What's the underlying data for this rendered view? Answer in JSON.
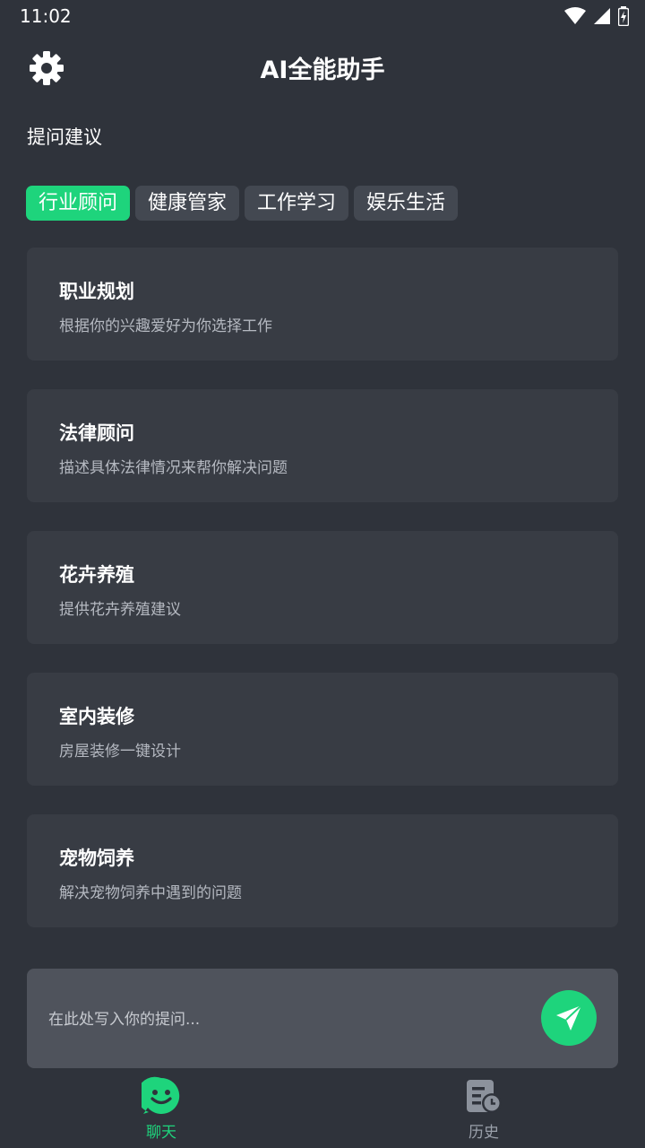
{
  "status_bar": {
    "time": "11:02"
  },
  "header": {
    "title": "AI全能助手",
    "settings_icon": "gear-icon"
  },
  "section": {
    "label": "提问建议"
  },
  "tabs": [
    {
      "label": "行业顾问",
      "active": true
    },
    {
      "label": "健康管家",
      "active": false
    },
    {
      "label": "工作学习",
      "active": false
    },
    {
      "label": "娱乐生活",
      "active": false
    }
  ],
  "cards": [
    {
      "title": "职业规划",
      "desc": "根据你的兴趣爱好为你选择工作"
    },
    {
      "title": "法律顾问",
      "desc": "描述具体法律情况来帮你解决问题"
    },
    {
      "title": "花卉养殖",
      "desc": "提供花卉养殖建议"
    },
    {
      "title": "室内装修",
      "desc": "房屋装修一键设计"
    },
    {
      "title": "宠物饲养",
      "desc": "解决宠物饲养中遇到的问题"
    }
  ],
  "input": {
    "placeholder": "在此处写入你的提问..."
  },
  "bottom_nav": {
    "chat_label": "聊天",
    "history_label": "历史"
  },
  "colors": {
    "background": "#2f333b",
    "card": "#383c44",
    "accent": "#1ed47c",
    "tab_inactive": "#434851",
    "input_bg": "#4f535c"
  }
}
